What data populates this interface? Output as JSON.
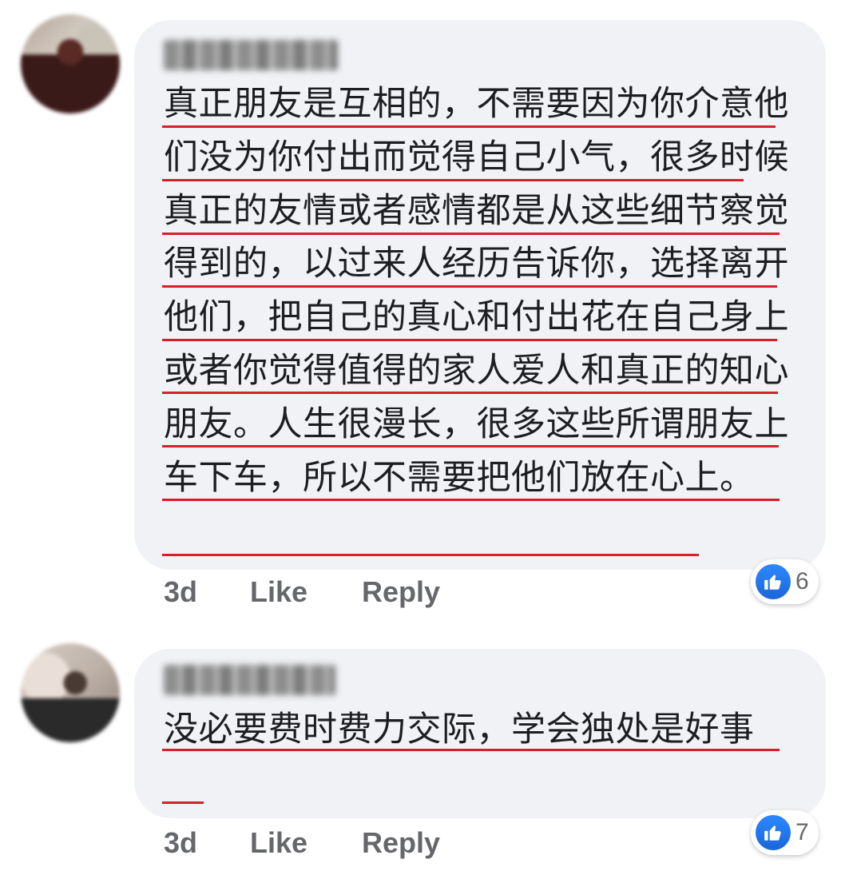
{
  "comments": [
    {
      "text": "真正朋友是互相的，不需要因为你介意他们没为你付出而觉得自己小气，很多时候真正的友情或者感情都是从这些细节察觉得到的，以过来人经历告诉你，选择离开他们，把自己的真心和付出花在自己身上或者你觉得值得的家人爱人和真正的知心朋友。人生很漫长，很多这些所谓朋友上车下车，所以不需要把他们放在心上。",
      "time": "3d",
      "like_label": "Like",
      "reply_label": "Reply",
      "reaction_count": "6",
      "reaction_icon": "thumbs-up-icon"
    },
    {
      "text": "没必要费时费力交际，学会独处是好事",
      "time": "3d",
      "like_label": "Like",
      "reply_label": "Reply",
      "reaction_count": "7",
      "reaction_icon": "thumbs-up-icon"
    }
  ],
  "colors": {
    "bubble_bg": "#f0f2f5",
    "underline": "#d6202a",
    "like_blue": "#2d88ff",
    "meta_text": "#65676b"
  }
}
